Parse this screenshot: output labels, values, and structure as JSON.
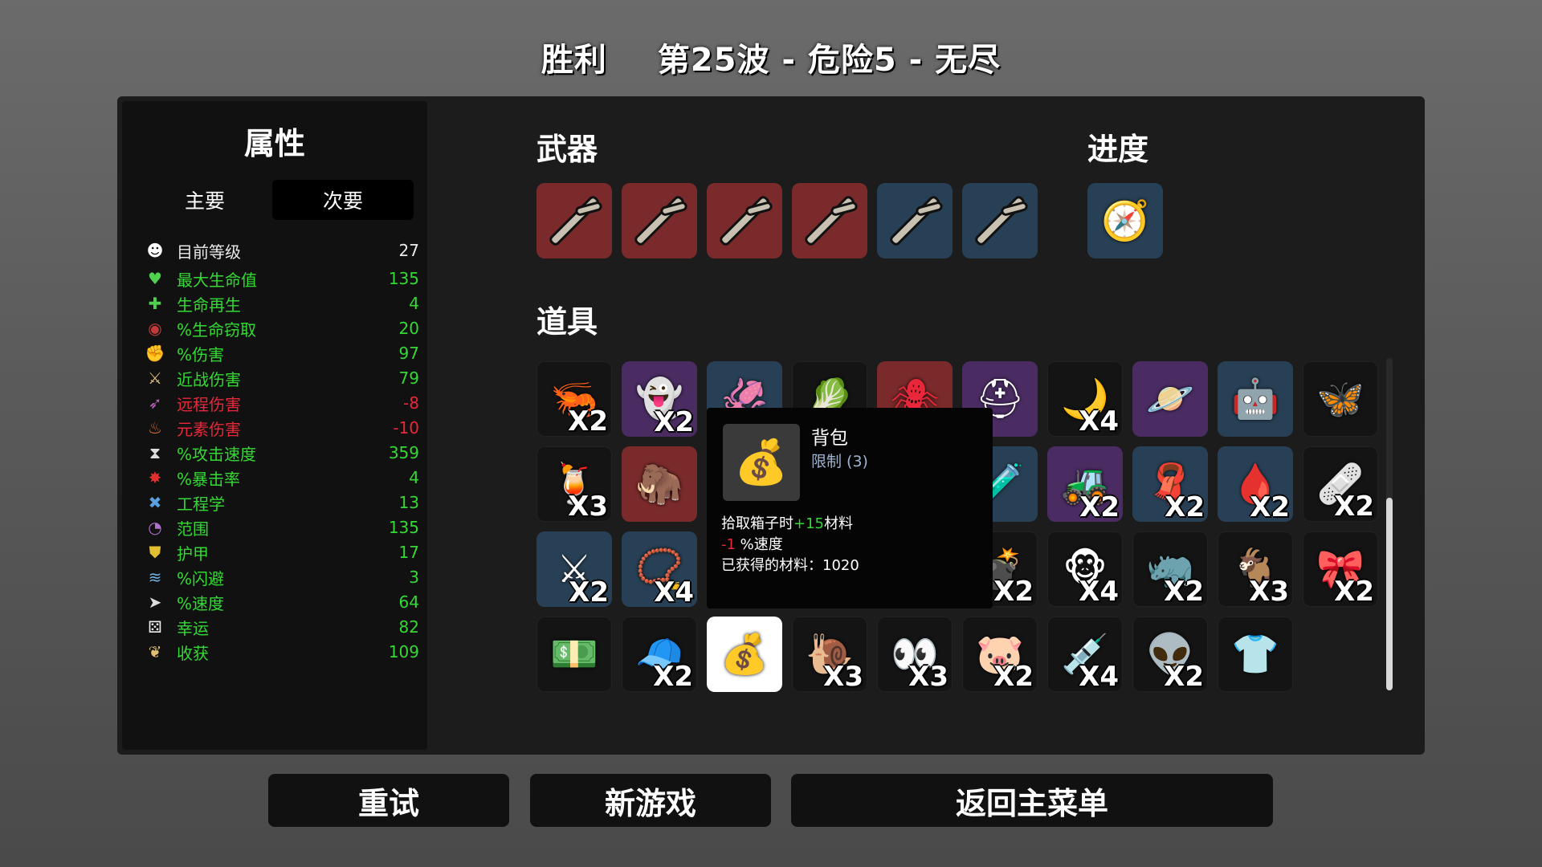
{
  "header": {
    "result": "胜利",
    "wave_info": "第25波 - 危险5 - 无尽"
  },
  "stats_panel": {
    "title": "属性",
    "tabs": [
      "主要",
      "次要"
    ],
    "level": {
      "label": "目前等级",
      "value": "27"
    },
    "rows": [
      {
        "label": "最大生命值",
        "value": "135",
        "color": "#34d934",
        "icon": "heart-icon"
      },
      {
        "label": "生命再生",
        "value": "4",
        "color": "#34d934",
        "icon": "regen-icon"
      },
      {
        "label": "%生命窃取",
        "value": "20",
        "color": "#34d934",
        "icon": "lifesteal-icon"
      },
      {
        "label": "%伤害",
        "value": "97",
        "color": "#34d934",
        "icon": "damage-icon"
      },
      {
        "label": "近战伤害",
        "value": "79",
        "color": "#34d934",
        "icon": "melee-icon"
      },
      {
        "label": "远程伤害",
        "value": "-8",
        "color": "#e8283a",
        "icon": "ranged-icon"
      },
      {
        "label": "元素伤害",
        "value": "-10",
        "color": "#e8283a",
        "icon": "elemental-icon"
      },
      {
        "label": "%攻击速度",
        "value": "359",
        "color": "#34d934",
        "icon": "attack-speed-icon"
      },
      {
        "label": "%暴击率",
        "value": "4",
        "color": "#34d934",
        "icon": "crit-icon"
      },
      {
        "label": "工程学",
        "value": "13",
        "color": "#34d934",
        "icon": "engineering-icon"
      },
      {
        "label": "范围",
        "value": "135",
        "color": "#34d934",
        "icon": "range-icon"
      },
      {
        "label": "护甲",
        "value": "17",
        "color": "#34d934",
        "icon": "armor-icon"
      },
      {
        "label": "%闪避",
        "value": "3",
        "color": "#34d934",
        "icon": "dodge-icon"
      },
      {
        "label": "%速度",
        "value": "64",
        "color": "#34d934",
        "icon": "speed-icon"
      },
      {
        "label": "幸运",
        "value": "82",
        "color": "#34d934",
        "icon": "luck-icon"
      },
      {
        "label": "收获",
        "value": "109",
        "color": "#34d934",
        "icon": "harvest-icon"
      }
    ]
  },
  "sections": {
    "weapons": "武器",
    "progress": "进度",
    "items": "道具"
  },
  "weapons": [
    {
      "tier": "red",
      "icon": "stick-icon"
    },
    {
      "tier": "red",
      "icon": "stick-icon"
    },
    {
      "tier": "red",
      "icon": "stick-icon"
    },
    {
      "tier": "red",
      "icon": "stick-icon"
    },
    {
      "tier": "blue",
      "icon": "stick-icon"
    },
    {
      "tier": "blue",
      "icon": "stick-icon"
    }
  ],
  "progress_items": [
    {
      "tier": "blue",
      "icon": "compass-icon"
    }
  ],
  "items": [
    [
      {
        "tier": "dark",
        "icon": "shrimp-icon",
        "glyph": "🦐",
        "count": "X2"
      },
      {
        "tier": "purple",
        "icon": "ghosts-icon",
        "glyph": "👻",
        "count": "X2"
      },
      {
        "tier": "blue",
        "icon": "tentacle-icon",
        "glyph": "🦑",
        "count": ""
      },
      {
        "tier": "dark",
        "icon": "cabbage-icon",
        "glyph": "🥬",
        "count": ""
      },
      {
        "tier": "red",
        "icon": "turret-icon",
        "glyph": "🕷",
        "count": ""
      },
      {
        "tier": "purple",
        "icon": "helmet-icon",
        "glyph": "⛑",
        "count": ""
      },
      {
        "tier": "dark",
        "icon": "claw-icon",
        "glyph": "🌙",
        "count": "X4"
      },
      {
        "tier": "purple",
        "icon": "drone-icon",
        "glyph": "🪐",
        "count": ""
      },
      {
        "tier": "blue",
        "icon": "robot-icon",
        "glyph": "🤖",
        "count": ""
      },
      {
        "tier": "dark",
        "icon": "butterfly-icon",
        "glyph": "🦋",
        "count": ""
      }
    ],
    [
      {
        "tier": "dark",
        "icon": "lemonade-icon",
        "glyph": "🍹",
        "count": "X3"
      },
      {
        "tier": "red",
        "icon": "mammoth-icon",
        "glyph": "🦣",
        "count": ""
      },
      {
        "tier": "blue",
        "icon": "hidden-icon",
        "glyph": "",
        "count": ""
      },
      {
        "tier": "dark",
        "icon": "hidden-icon",
        "glyph": "",
        "count": ""
      },
      {
        "tier": "dark",
        "icon": "hidden-icon",
        "glyph": "",
        "count": ""
      },
      {
        "tier": "blue",
        "icon": "potion-icon",
        "glyph": "🧪",
        "count": ""
      },
      {
        "tier": "purple",
        "icon": "tractor-icon",
        "glyph": "🚜",
        "count": "X2"
      },
      {
        "tier": "blue",
        "icon": "scarf-icon",
        "glyph": "🧣",
        "count": "X2"
      },
      {
        "tier": "blue",
        "icon": "blood-cells-icon",
        "glyph": "🩸",
        "count": "X2"
      },
      {
        "tier": "dark",
        "icon": "bandage-icon",
        "glyph": "🩹",
        "count": "X2"
      }
    ],
    [
      {
        "tier": "blue",
        "icon": "fighter-icon",
        "glyph": "⚔",
        "count": "X2"
      },
      {
        "tier": "blue",
        "icon": "coin-necklace-icon",
        "glyph": "📿",
        "count": "X4"
      },
      {
        "tier": "dark",
        "icon": "hidden-icon",
        "glyph": "",
        "count": ""
      },
      {
        "tier": "dark",
        "icon": "hidden-icon",
        "glyph": "",
        "count": ""
      },
      {
        "tier": "dark",
        "icon": "hidden-icon",
        "glyph": "",
        "count": ""
      },
      {
        "tier": "dark",
        "icon": "bomb-icon",
        "glyph": "💣",
        "count": "X2"
      },
      {
        "tier": "dark",
        "icon": "monkey-icon",
        "glyph": "🐵",
        "count": "X4"
      },
      {
        "tier": "dark",
        "icon": "horn-icon",
        "glyph": "🦏",
        "count": "X2"
      },
      {
        "tier": "dark",
        "icon": "goat-skull-icon",
        "glyph": "🐐",
        "count": "X3"
      },
      {
        "tier": "dark",
        "icon": "scarf-red-icon",
        "glyph": "🎀",
        "count": "X2"
      }
    ],
    [
      {
        "tier": "dark",
        "icon": "cash-icon",
        "glyph": "💵",
        "count": ""
      },
      {
        "tier": "dark",
        "icon": "propeller-hat-icon",
        "glyph": "🧢",
        "count": "X2"
      },
      {
        "tier": "selected",
        "icon": "bag-icon",
        "glyph": "💰",
        "count": ""
      },
      {
        "tier": "dark",
        "icon": "snail-icon",
        "glyph": "🐌",
        "count": "X3"
      },
      {
        "tier": "dark",
        "icon": "eyes-icon",
        "glyph": "👀",
        "count": "X3"
      },
      {
        "tier": "dark",
        "icon": "pig-icon",
        "glyph": "🐷",
        "count": "X2"
      },
      {
        "tier": "dark",
        "icon": "syringe-icon",
        "glyph": "💉",
        "count": "X4"
      },
      {
        "tier": "dark",
        "icon": "alien-icon",
        "glyph": "👽",
        "count": "X2"
      },
      {
        "tier": "dark",
        "icon": "flannel-shirt-icon",
        "glyph": "👕",
        "count": ""
      }
    ]
  ],
  "tooltip": {
    "name": "背包",
    "limit": "限制 (3)",
    "line1_a": "拾取箱子时",
    "line1_b": "+15",
    "line1_c": "材料",
    "line2_a": "-1",
    "line2_b": " %速度",
    "line3": "已获得的材料：1020",
    "icon": "bag-icon"
  },
  "buttons": {
    "retry": "重试",
    "new_game": "新游戏",
    "main_menu": "返回主菜单"
  }
}
